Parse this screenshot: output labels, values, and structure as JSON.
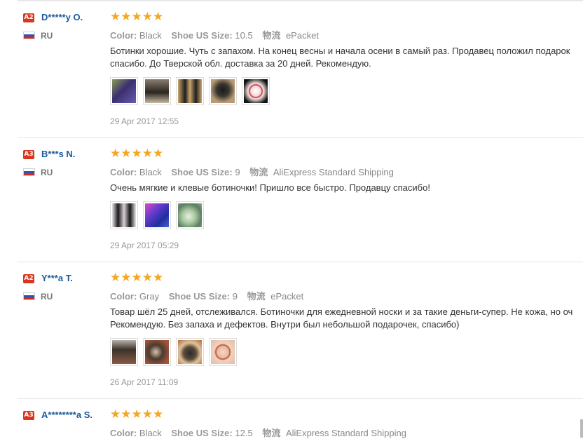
{
  "reviews": [
    {
      "badge": "A2",
      "user": "D*****y O.",
      "country": "RU",
      "stars": "★★★★★",
      "color_label": "Color:",
      "color_value": "Black",
      "size_label": "Shoe US Size:",
      "size_value": "10.5",
      "shipping_label": "物流",
      "shipping_value": "ePacket",
      "text_lines": [
        "Ботинки хорошие. Чуть с запахом. На конец весны и начала осени в самый раз. Продавец положил подарок",
        "спасибо. До Тверской обл. доставка за 20 дней. Рекомендую."
      ],
      "photos": [
        "photo-boot-purple",
        "photo-boot-worn",
        "photo-boot-pair",
        "photo-boot-side",
        "photo-gift-bracelet"
      ],
      "date": "29 Apr 2017 12:55"
    },
    {
      "badge": "A3",
      "user": "B***s N.",
      "country": "RU",
      "stars": "★★★★★",
      "color_label": "Color:",
      "color_value": "Black",
      "size_label": "Shoe US Size:",
      "size_value": "9",
      "shipping_label": "物流",
      "shipping_value": "AliExpress Standard Shipping",
      "text_lines": [
        "Очень мягкие и клевые ботиночки! Пришло все быстро. Продавцу спасибо!"
      ],
      "photos": [
        "photo-boot-pair",
        "photo-socks-blue",
        "photo-gift-green"
      ],
      "date": "29 Apr 2017 05:29"
    },
    {
      "badge": "A2",
      "user": "Y***a T.",
      "country": "RU",
      "stars": "★★★★★",
      "color_label": "Color:",
      "color_value": "Gray",
      "size_label": "Shoe US Size:",
      "size_value": "9",
      "shipping_label": "物流",
      "shipping_value": "ePacket",
      "text_lines": [
        "Товар шёл 25 дней, отслеживался. Ботиночки для ежедневной носки и за такие деньги-супер. Не кожа, но оч",
        "Рекомендую. Без запаха и дефектов. Внутри был небольшой подарочек, спасибо)"
      ],
      "photos": [
        "photo-boot-gray",
        "photo-boot-gray-side",
        "photo-boot-inside",
        "photo-gift-bracelet"
      ],
      "date": "26 Apr 2017 11:09"
    },
    {
      "badge": "A3",
      "user": "A********a S.",
      "country": "",
      "stars": "★★★★★",
      "color_label": "Color:",
      "color_value": "Black",
      "size_label": "Shoe US Size:",
      "size_value": "12.5",
      "shipping_label": "物流",
      "shipping_value": "AliExpress Standard Shipping",
      "text_lines": [],
      "photos": [],
      "date": ""
    }
  ],
  "colors": {
    "username": "#1a5a9b",
    "badge": "#d8361e",
    "stars": "#f5a623"
  },
  "icons": {
    "flag": "russia-flag-icon",
    "badge": "level-badge-icon",
    "star": "star-icon"
  }
}
